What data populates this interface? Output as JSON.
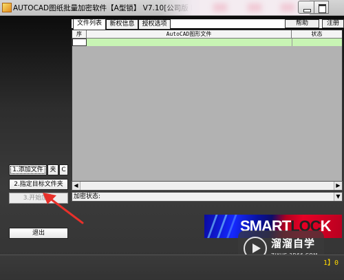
{
  "window": {
    "title": "AUTOCAD图纸批量加密软件【A型锁】 V7.10[公司版 ID:"
  },
  "tabs": [
    {
      "label": "文件列表",
      "active": true
    },
    {
      "label": "新权信息",
      "active": false
    },
    {
      "label": "授权选项",
      "active": false
    }
  ],
  "top_buttons": {
    "help": "帮助",
    "register": "注册"
  },
  "file_table": {
    "columns": [
      "序",
      "AutoCAD图形文件",
      "状态"
    ],
    "rows": []
  },
  "status_bar": {
    "label": "加密状态:"
  },
  "left_panel": {
    "add_files": "1.添加文件",
    "folder": "夹",
    "clear": "C",
    "set_target_folder": "2.指定目标文件夹",
    "start_encrypt": "3.开始加密",
    "exit": "退出"
  },
  "logo": {
    "part1": "SMART",
    "part2": "LOC",
    "part3": "K"
  },
  "watermark": {
    "name": "溜溜自学",
    "url": "ZIXUE.3D66.COM"
  },
  "bottom": {
    "text": "1】0",
    "icon": "pause-icon"
  },
  "colors": {
    "table_selected_row": "#c8f5b4",
    "annotation_arrow": "#e8302a"
  }
}
